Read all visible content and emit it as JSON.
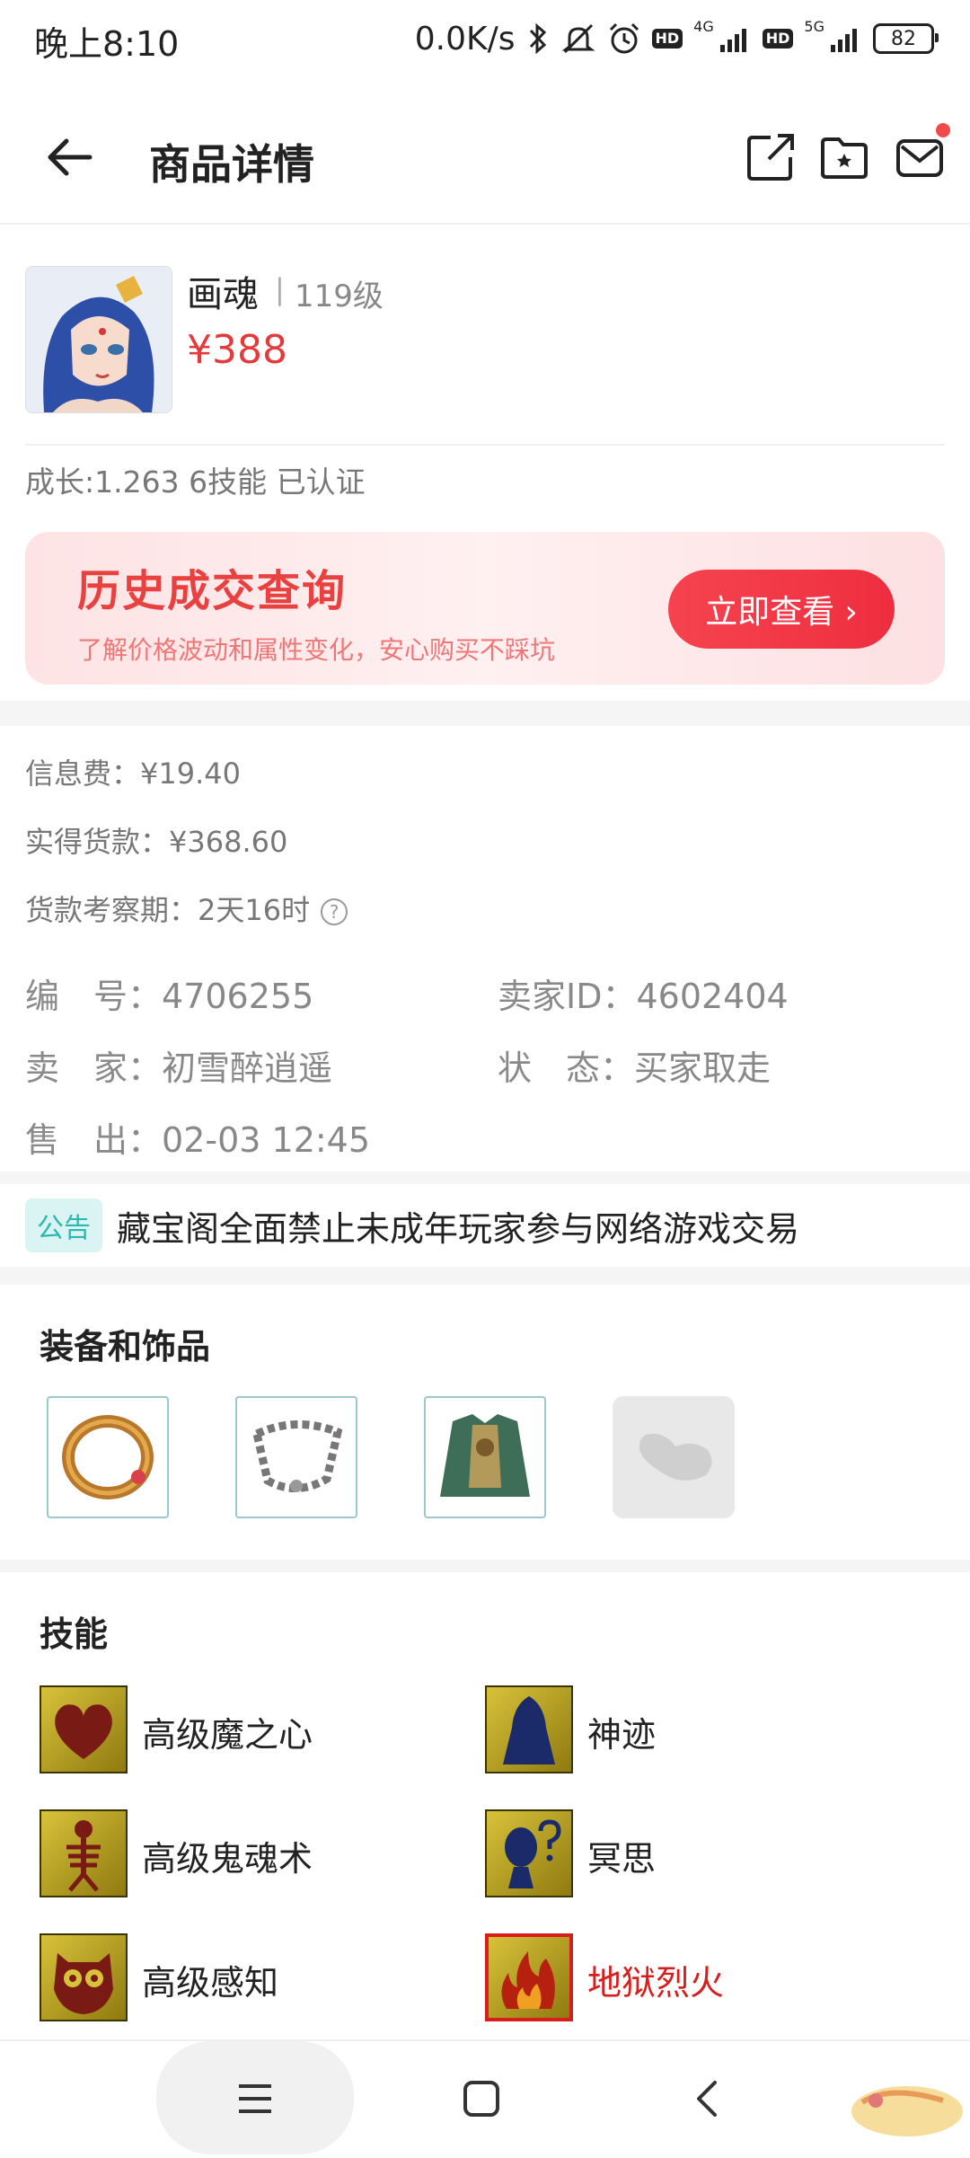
{
  "status_bar": {
    "time": "晚上8:10",
    "speed": "0.0K/s",
    "net1": "4G",
    "net2": "5G",
    "battery": "82"
  },
  "header": {
    "title": "商品详情"
  },
  "product": {
    "name": "画魂",
    "separator": "|",
    "level": "119级",
    "price": "¥388",
    "attributes": "成长:1.263 6技能 已认证"
  },
  "history_banner": {
    "title": "历史成交查询",
    "subtitle": "了解价格波动和属性变化，安心购买不踩坑",
    "button_label": "立即查看 ›"
  },
  "fees": {
    "info_fee": "信息费：¥19.40",
    "actual_payment": "实得货款：¥368.60",
    "review_period": "货款考察期：2天16时",
    "help": "?"
  },
  "details": {
    "number_label": "编　号：",
    "number": "4706255",
    "seller_id_label": "卖家ID：",
    "seller_id": "4602404",
    "seller_label": "卖　家：",
    "seller": "初雪醉逍遥",
    "status_label": "状　态：",
    "status": "买家取走",
    "sold_label": "售　出：",
    "sold": "02-03 12:45"
  },
  "notice": {
    "tag": "公告",
    "text": "藏宝阁全面禁止未成年玩家参与网络游戏交易"
  },
  "equipment": {
    "title": "装备和饰品"
  },
  "skills": {
    "title": "技能",
    "items": [
      {
        "name": "高级魔之心",
        "icon": "heart-skill-icon"
      },
      {
        "name": "神迹",
        "icon": "robe-skill-icon"
      },
      {
        "name": "高级鬼魂术",
        "icon": "skeleton-skill-icon"
      },
      {
        "name": "冥思",
        "icon": "meditation-skill-icon"
      },
      {
        "name": "高级感知",
        "icon": "owl-skill-icon"
      },
      {
        "name": "地狱烈火",
        "icon": "fire-skill-icon"
      }
    ]
  },
  "colors": {
    "accent_red": "#e33b3b",
    "notice_teal": "#2bb8b0",
    "skill_bg": "#c9b22a"
  }
}
